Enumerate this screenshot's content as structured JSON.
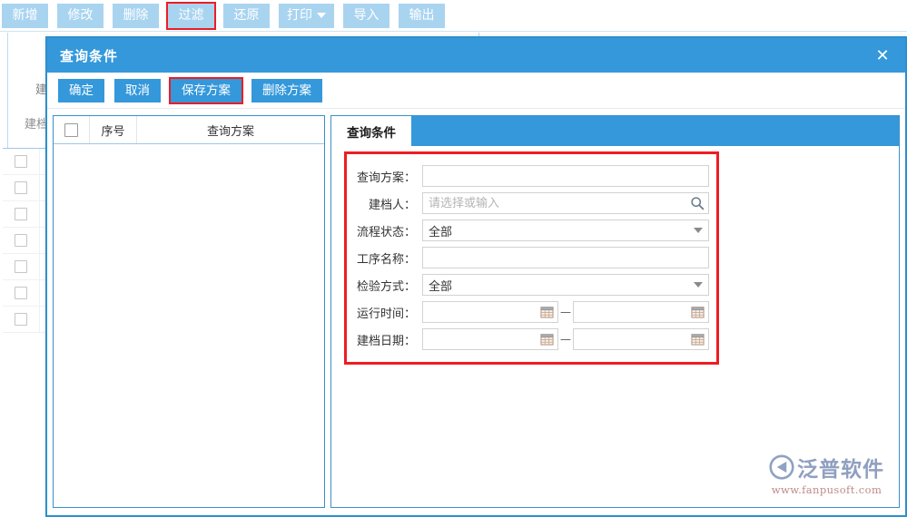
{
  "background": {
    "toolbar": {
      "buttons": [
        {
          "label": "新增",
          "icon": "",
          "highlighted": false
        },
        {
          "label": "修改",
          "icon": "",
          "highlighted": false
        },
        {
          "label": "删除",
          "icon": "",
          "highlighted": false
        },
        {
          "label": "过滤",
          "icon": "",
          "highlighted": true
        },
        {
          "label": "还原",
          "icon": "",
          "highlighted": false
        },
        {
          "label": "打印",
          "icon": "chevron-down-icon",
          "highlighted": false
        },
        {
          "label": "导入",
          "icon": "",
          "highlighted": false
        },
        {
          "label": "输出",
          "icon": "",
          "highlighted": false
        }
      ]
    },
    "obscured_labels": {
      "label_a": "建",
      "label_b": "建档"
    },
    "table_row_count": 7
  },
  "dialog": {
    "title": "查询条件",
    "close_icon": "close-icon",
    "toolbar": [
      {
        "label": "确定",
        "highlighted": false
      },
      {
        "label": "取消",
        "highlighted": false
      },
      {
        "label": "保存方案",
        "highlighted": true
      },
      {
        "label": "删除方案",
        "highlighted": false
      }
    ],
    "scheme_list": {
      "columns": [
        "",
        "序号",
        "查询方案"
      ],
      "rows": []
    },
    "tabs": [
      {
        "label": "查询条件",
        "active": true
      }
    ],
    "form": {
      "fields": [
        {
          "label": "查询方案：",
          "type": "text",
          "value": "",
          "placeholder": ""
        },
        {
          "label": "建档人：",
          "type": "search",
          "value": "",
          "placeholder": "请选择或输入",
          "icon": "search-icon"
        },
        {
          "label": "流程状态：",
          "type": "select",
          "value": "全部",
          "placeholder": "",
          "icon": "chevron-down-icon"
        },
        {
          "label": "工序名称：",
          "type": "text",
          "value": "",
          "placeholder": ""
        },
        {
          "label": "检验方式：",
          "type": "select",
          "value": "全部",
          "placeholder": "",
          "icon": "chevron-down-icon"
        },
        {
          "label": "运行时间：",
          "type": "daterange",
          "value_from": "",
          "value_to": "",
          "separator": "—",
          "icon": "calendar-icon"
        },
        {
          "label": "建档日期：",
          "type": "daterange",
          "value_from": "",
          "value_to": "",
          "separator": "—",
          "icon": "calendar-icon"
        }
      ]
    }
  },
  "watermark": {
    "brand": "泛普软件",
    "url": "www.fanpusoft.com",
    "logo_icon": "fanpu-logo-icon"
  },
  "colors": {
    "header_blue": "#3498db",
    "toolbar_button_blue": "#a9d4f0",
    "highlight_red": "#ee1c23",
    "border_blue": "#2e8fcc"
  }
}
